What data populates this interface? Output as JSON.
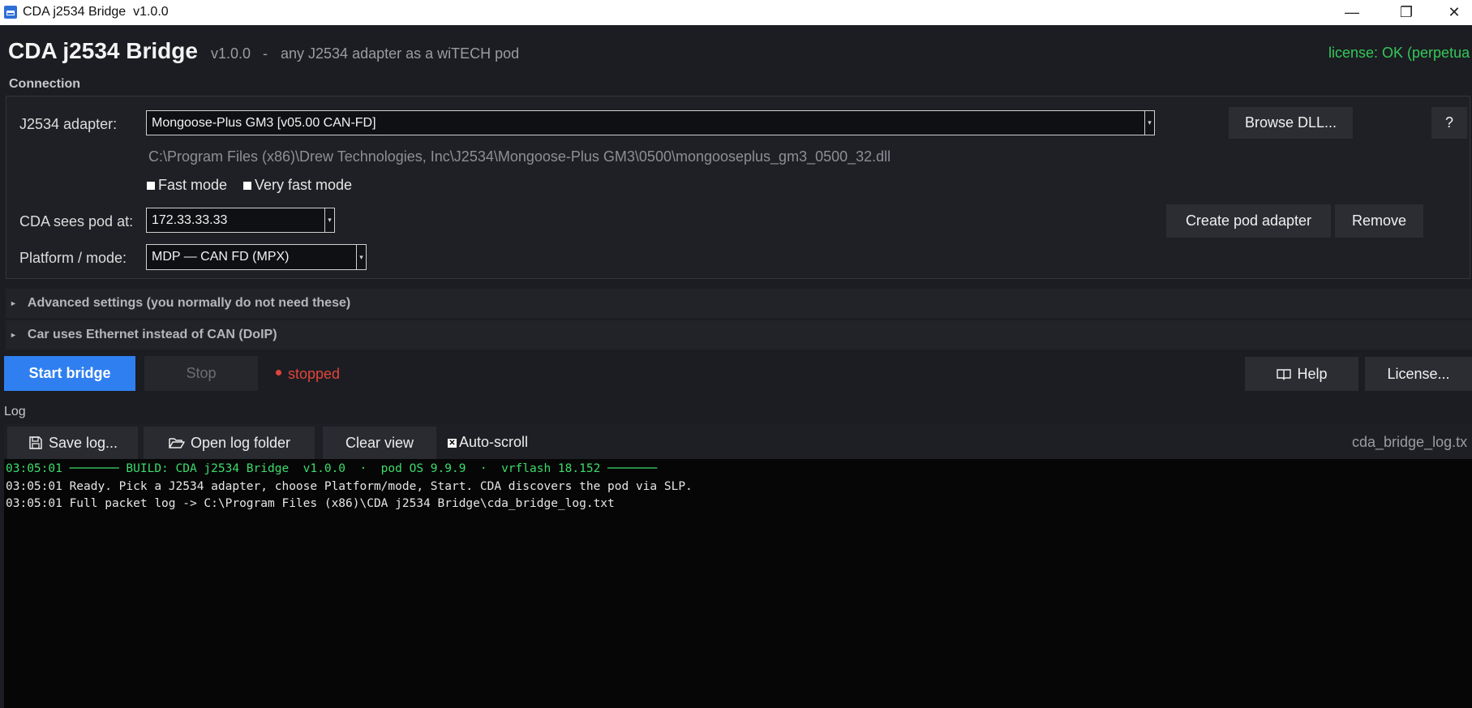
{
  "window": {
    "title": "CDA j2534 Bridge  v1.0.0",
    "controls": {
      "minimize": "—",
      "maximize": "❐",
      "close": "✕"
    }
  },
  "header": {
    "app_name": "CDA j2534 Bridge",
    "version": "v1.0.0",
    "separator": "-",
    "tagline": "any J2534 adapter as a wiTECH pod",
    "license_status": "license: OK (perpetua"
  },
  "connection": {
    "heading": "Connection",
    "adapter_label": "J2534 adapter:",
    "adapter_value": "Mongoose-Plus GM3  [v05.00 CAN-FD]",
    "dll_path": "C:\\Program Files (x86)\\Drew Technologies, Inc\\J2534\\Mongoose-Plus GM3\\0500\\mongooseplus_gm3_0500_32.dll",
    "browse_button": "Browse DLL...",
    "help_small_button": "?",
    "fast_mode_label": "Fast mode",
    "very_fast_mode_label": "Very fast mode",
    "pod_label": "CDA sees pod at:",
    "pod_value": "172.33.33.33",
    "create_pod_button": "Create pod adapter",
    "remove_button": "Remove",
    "platform_label": "Platform / mode:",
    "platform_value": "MDP — CAN FD  (MPX)"
  },
  "sections": {
    "advanced": "Advanced settings  (you normally do not need these)",
    "doip": "Car uses Ethernet instead of CAN  (DoIP)"
  },
  "controls": {
    "start_button": "Start bridge",
    "stop_button": "Stop",
    "status_text": "stopped",
    "help_button": "Help",
    "license_button": "License..."
  },
  "log": {
    "heading": "Log",
    "save_button": "Save log...",
    "open_folder_button": "Open log folder",
    "clear_button": "Clear view",
    "autoscroll_label": "Auto-scroll",
    "filename": "cda_bridge_log.tx",
    "lines": [
      "03:05:01 ─────── BUILD: CDA j2534 Bridge  v1.0.0  ·  pod OS 9.9.9  ·  vrflash 18.152 ───────",
      "03:05:01 Ready. Pick a J2534 adapter, choose Platform/mode, Start. CDA discovers the pod via SLP.",
      "03:05:01 Full packet log -> C:\\Program Files (x86)\\CDA j2534 Bridge\\cda_bridge_log.txt"
    ]
  },
  "colors": {
    "accent": "#2f7ff0",
    "license_ok": "#34c759",
    "status_stopped": "#e0453a",
    "log_build_line": "#3ddc6a",
    "background": "#1c1d22"
  },
  "icons": {
    "app": "app-icon",
    "save": "floppy-disk-icon",
    "folder": "folder-open-icon",
    "help": "book-icon",
    "dropdown": "chevron-down-icon",
    "expand": "triangle-right-icon"
  }
}
